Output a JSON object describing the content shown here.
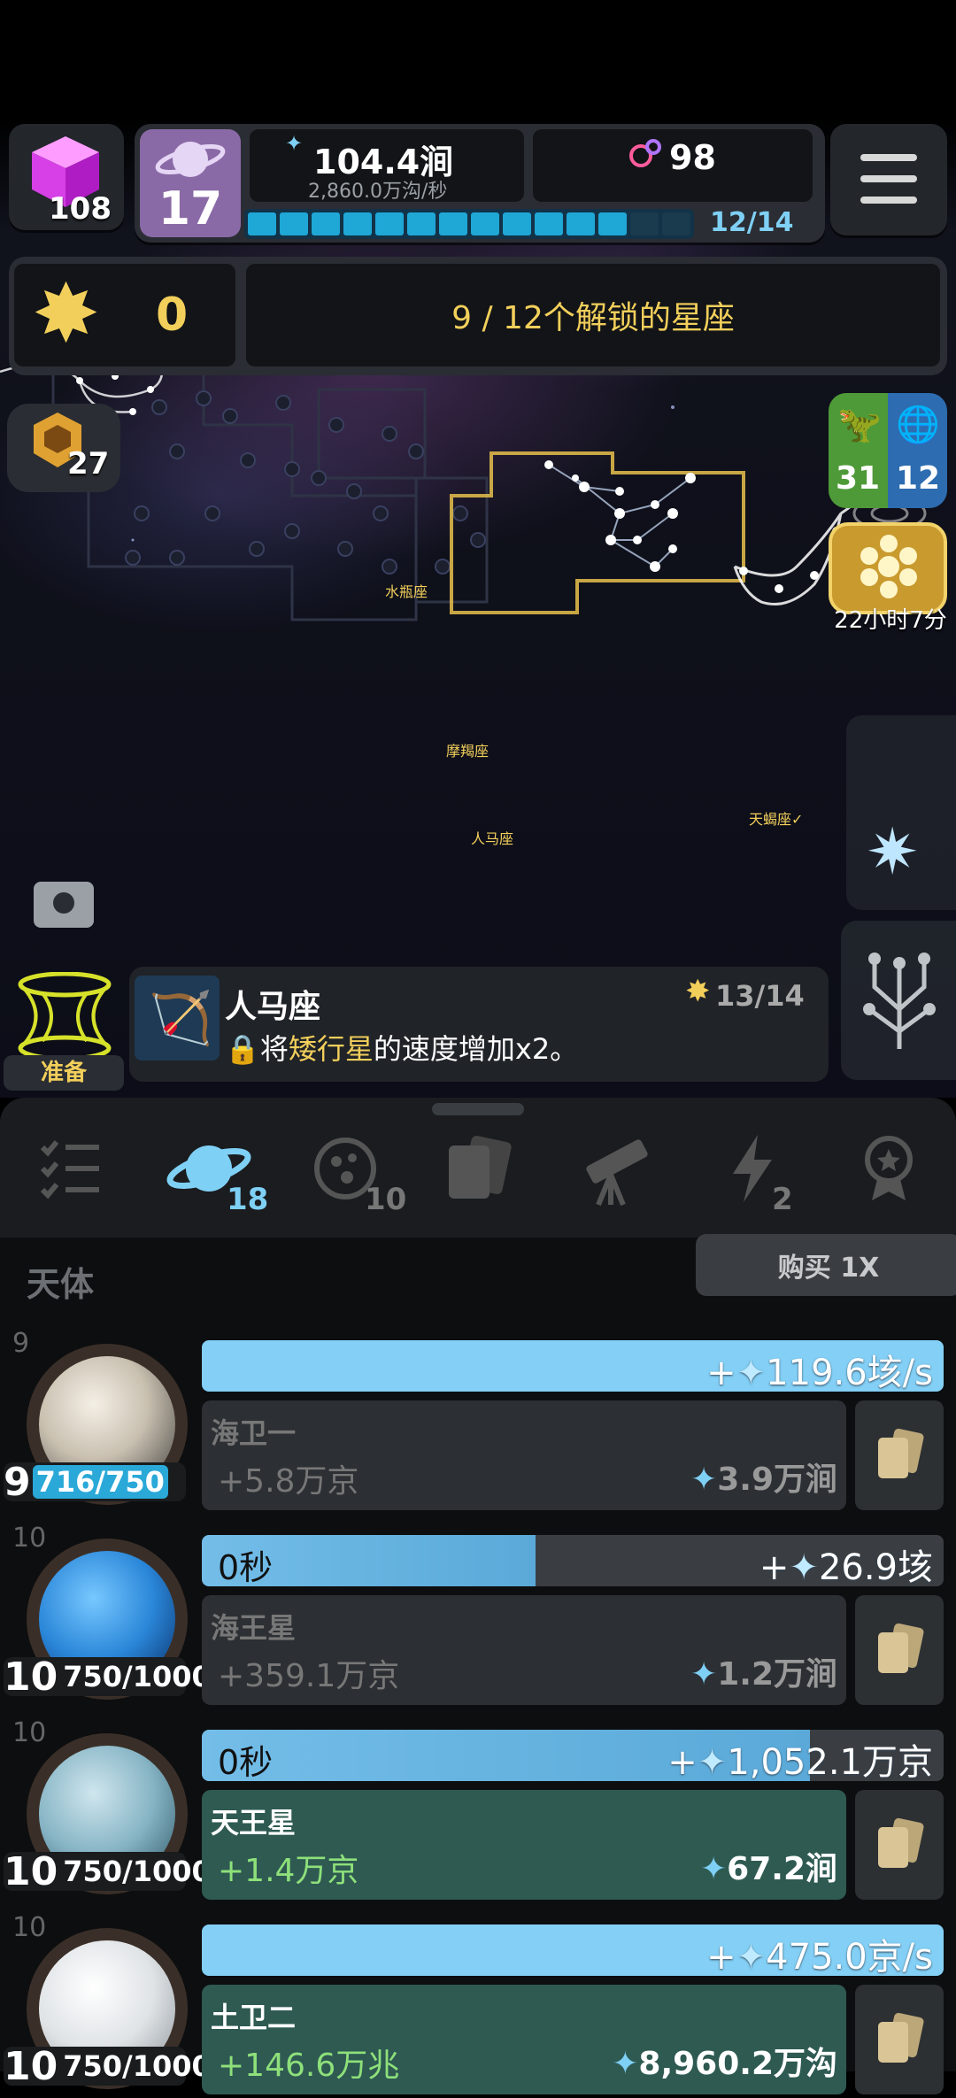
{
  "hud": {
    "cube_count": "108",
    "planet_level": "17",
    "energy_value": "104.4涧",
    "energy_rate": "2,860.0万沟/秒",
    "molecule_count": "98",
    "progress_label": "12/14",
    "progress_fraction": 0.857,
    "progress_segments": 14,
    "progress_filled": 12
  },
  "star_bar": {
    "star_count": "0",
    "unlock_text": "9 / 12个解锁的星座"
  },
  "side": {
    "gem_count": "27",
    "dino_count": "31",
    "globe_count": "12",
    "timer_text": "22小时7分"
  },
  "constellations": {
    "aquarius": "水瓶座",
    "capricorn": "摩羯座",
    "sagittarius": "人马座",
    "scorpio": "天蝎座"
  },
  "info": {
    "ready_label": "准备",
    "name": "人马座",
    "stars": "13/14",
    "desc_prefix": "将",
    "desc_highlight": "矮行星",
    "desc_suffix": "的速度增加x2。"
  },
  "tabs": {
    "planets_count": "18",
    "moons_count": "10",
    "lightning_count": "2"
  },
  "list": {
    "section_title": "天体",
    "buy_label": "购买 1X",
    "rows": [
      {
        "level": "9",
        "badge_level": "9",
        "progress": "716/750",
        "timer": "",
        "rate": "119.6垓/s",
        "name": "海卫一",
        "gain": "+5.8万京",
        "cost": "3.9万涧",
        "timer_fill": 1.0
      },
      {
        "level": "10",
        "badge_level": "10",
        "progress": "750/1000",
        "timer": "0秒",
        "rate": "26.9垓",
        "name": "海王星",
        "gain": "+359.1万京",
        "cost": "1.2万涧",
        "timer_fill": 0.45
      },
      {
        "level": "10",
        "badge_level": "10",
        "progress": "750/1000",
        "timer": "0秒",
        "rate": "1,052.1万京",
        "name": "天王星",
        "gain": "+1.4万京",
        "cost": "67.2涧",
        "timer_fill": 0.82
      },
      {
        "level": "10",
        "badge_level": "10",
        "progress": "750/1000",
        "timer": "",
        "rate": "475.0京/s",
        "name": "土卫二",
        "gain": "+146.6万兆",
        "cost": "8,960.2万沟",
        "timer_fill": 1.0
      }
    ]
  },
  "colors": {
    "accent_blue": "#7fd0f5",
    "gold": "#f2cf5b",
    "green_text": "#8ee07a",
    "teal_card": "#2e5a52"
  }
}
